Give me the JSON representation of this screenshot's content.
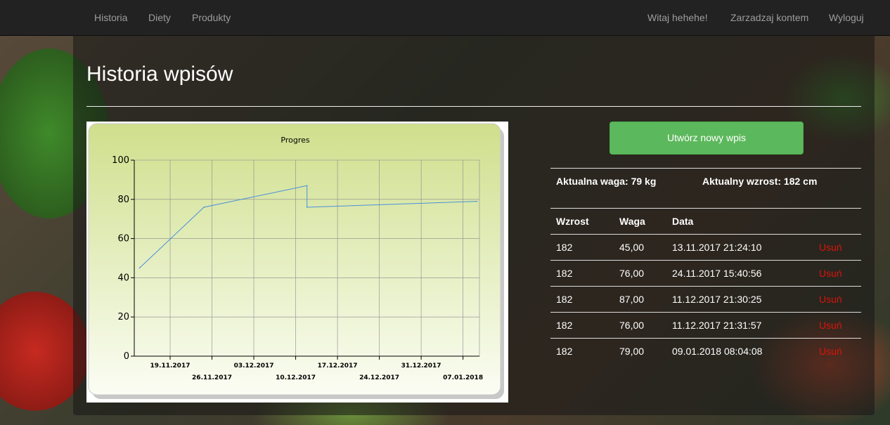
{
  "nav": {
    "left": [
      "Historia",
      "Diety",
      "Produkty"
    ],
    "right": [
      "Witaj hehehe!",
      "Zarzadzaj kontem",
      "Wyloguj"
    ]
  },
  "page": {
    "title": "Historia wpisów"
  },
  "actions": {
    "create_label": "Utwórz nowy wpis"
  },
  "summary": {
    "weight": "Aktualna waga: 79 kg",
    "height": "Aktualny wzrost: 182 cm"
  },
  "table": {
    "headers": [
      "Wzrost",
      "Waga",
      "Data"
    ],
    "rows": [
      {
        "height": "182",
        "weight": "45,00",
        "date": "13.11.2017 21:24:10",
        "action": "Usuń"
      },
      {
        "height": "182",
        "weight": "76,00",
        "date": "24.11.2017 15:40:56",
        "action": "Usuń"
      },
      {
        "height": "182",
        "weight": "87,00",
        "date": "11.12.2017 21:30:25",
        "action": "Usuń"
      },
      {
        "height": "182",
        "weight": "76,00",
        "date": "11.12.2017 21:31:57",
        "action": "Usuń"
      },
      {
        "height": "182",
        "weight": "79,00",
        "date": "09.01.2018 08:04:08",
        "action": "Usuń"
      }
    ]
  },
  "colors": {
    "accent_button": "#5cb85c",
    "delete_link": "#d9140a",
    "chart_line": "#4a90d9"
  },
  "chart_data": {
    "type": "line",
    "title": "Progres",
    "xlabel": "",
    "ylabel": "",
    "ylim": [
      0,
      100
    ],
    "yticks": [
      0,
      20,
      40,
      60,
      80,
      100
    ],
    "xlim": [
      "13.11.2017",
      "09.01.2018"
    ],
    "x_tick_labels": [
      "19.11.2017",
      "26.11.2017",
      "03.12.2017",
      "10.12.2017",
      "17.12.2017",
      "24.12.2017",
      "31.12.2017",
      "07.01.2018"
    ],
    "grid": true,
    "series": [
      {
        "points": [
          {
            "x": "13.11.2017 21:24:10",
            "y": 45
          },
          {
            "x": "24.11.2017 15:40:56",
            "y": 76
          },
          {
            "x": "11.12.2017 21:30:25",
            "y": 87
          },
          {
            "x": "11.12.2017 21:31:57",
            "y": 76
          },
          {
            "x": "09.01.2018 08:04:08",
            "y": 79
          }
        ]
      }
    ]
  }
}
